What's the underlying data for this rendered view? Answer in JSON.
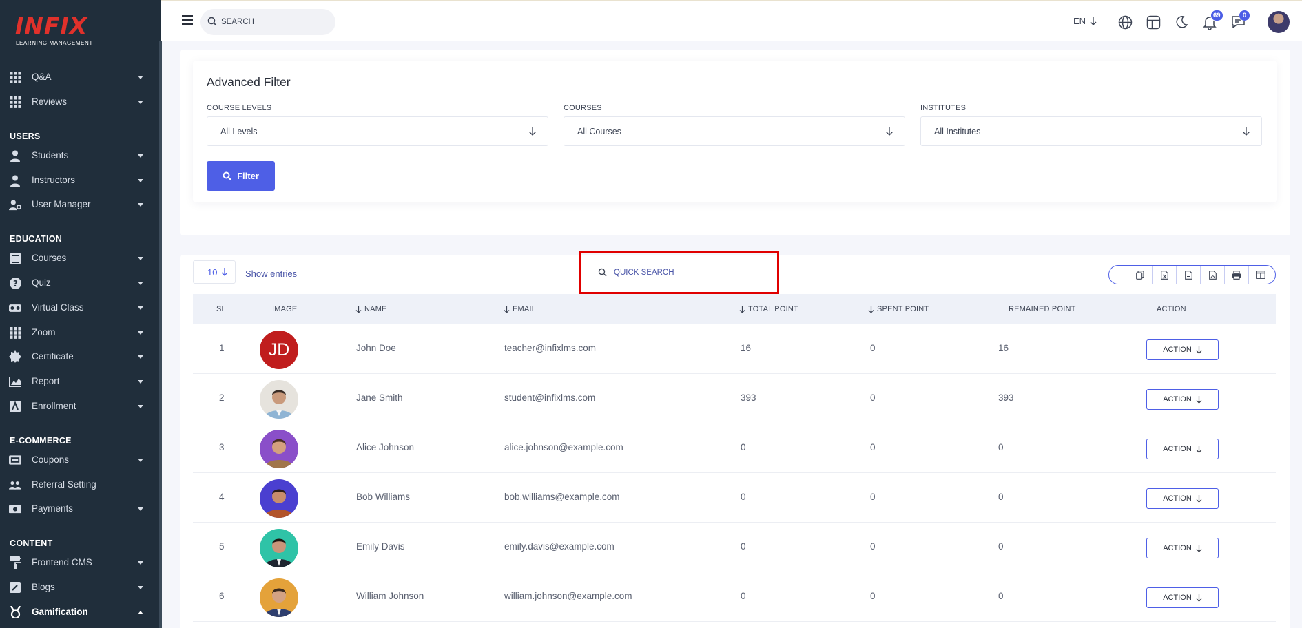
{
  "app": {
    "logo_text": "INFIX",
    "logo_subtitle": "LEARNING MANAGEMENT",
    "brand_color": "#e0312b",
    "accent_color": "#4e5fe6"
  },
  "sidebar": {
    "items_top": [
      {
        "label": "Q&A",
        "icon": "grid-icon"
      },
      {
        "label": "Reviews",
        "icon": "grid-icon"
      }
    ],
    "sections": [
      {
        "title": "USERS",
        "items": [
          {
            "label": "Students",
            "icon": "user-icon"
          },
          {
            "label": "Instructors",
            "icon": "user-icon"
          },
          {
            "label": "User Manager",
            "icon": "user-gear-icon"
          }
        ]
      },
      {
        "title": "EDUCATION",
        "items": [
          {
            "label": "Courses",
            "icon": "book-icon"
          },
          {
            "label": "Quiz",
            "icon": "question-icon"
          },
          {
            "label": "Virtual Class",
            "icon": "vr-icon"
          },
          {
            "label": "Zoom",
            "icon": "grid-icon"
          },
          {
            "label": "Certificate",
            "icon": "badge-icon"
          },
          {
            "label": "Report",
            "icon": "chart-icon"
          },
          {
            "label": "Enrollment",
            "icon": "enroll-icon"
          }
        ]
      },
      {
        "title": "E-COMMERCE",
        "items": [
          {
            "label": "Coupons",
            "icon": "ticket-icon"
          },
          {
            "label": "Referral Setting",
            "icon": "users-icon"
          },
          {
            "label": "Payments",
            "icon": "money-icon"
          }
        ]
      },
      {
        "title": "CONTENT",
        "items": [
          {
            "label": "Frontend CMS",
            "icon": "paint-roller-icon"
          },
          {
            "label": "Blogs",
            "icon": "edit-icon"
          },
          {
            "label": "Gamification",
            "icon": "medal-icon"
          }
        ]
      }
    ]
  },
  "header": {
    "search_placeholder": "SEARCH",
    "language": "EN",
    "notifications_count": "69",
    "messages_count": "0"
  },
  "filter": {
    "title": "Advanced Filter",
    "fields": [
      {
        "label": "COURSE LEVELS",
        "value": "All Levels"
      },
      {
        "label": "COURSES",
        "value": "All Courses"
      },
      {
        "label": "INSTITUTES",
        "value": "All Institutes"
      }
    ],
    "button_label": "Filter"
  },
  "table": {
    "page_size": "10",
    "entries_label": "Show entries",
    "quick_search_placeholder": "QUICK SEARCH",
    "columns": [
      "SL",
      "IMAGE",
      "NAME",
      "EMAIL",
      "TOTAL POINT",
      "SPENT POINT",
      "REMAINED POINT",
      "ACTION"
    ],
    "rows": [
      {
        "sl": "1",
        "initials": "JD",
        "name": "John Doe",
        "email": "teacher@infixlms.com",
        "total": "16",
        "spent": "0",
        "remained": "16",
        "action": "ACTION"
      },
      {
        "sl": "2",
        "initials": "",
        "name": "Jane Smith",
        "email": "student@infixlms.com",
        "total": "393",
        "spent": "0",
        "remained": "393",
        "action": "ACTION"
      },
      {
        "sl": "3",
        "initials": "",
        "name": "Alice Johnson",
        "email": "alice.johnson@example.com",
        "total": "0",
        "spent": "0",
        "remained": "0",
        "action": "ACTION"
      },
      {
        "sl": "4",
        "initials": "",
        "name": "Bob Williams",
        "email": "bob.williams@example.com",
        "total": "0",
        "spent": "0",
        "remained": "0",
        "action": "ACTION"
      },
      {
        "sl": "5",
        "initials": "",
        "name": "Emily Davis",
        "email": "emily.davis@example.com",
        "total": "0",
        "spent": "0",
        "remained": "0",
        "action": "ACTION"
      },
      {
        "sl": "6",
        "initials": "",
        "name": "William Johnson",
        "email": "william.johnson@example.com",
        "total": "0",
        "spent": "0",
        "remained": "0",
        "action": "ACTION"
      }
    ]
  }
}
